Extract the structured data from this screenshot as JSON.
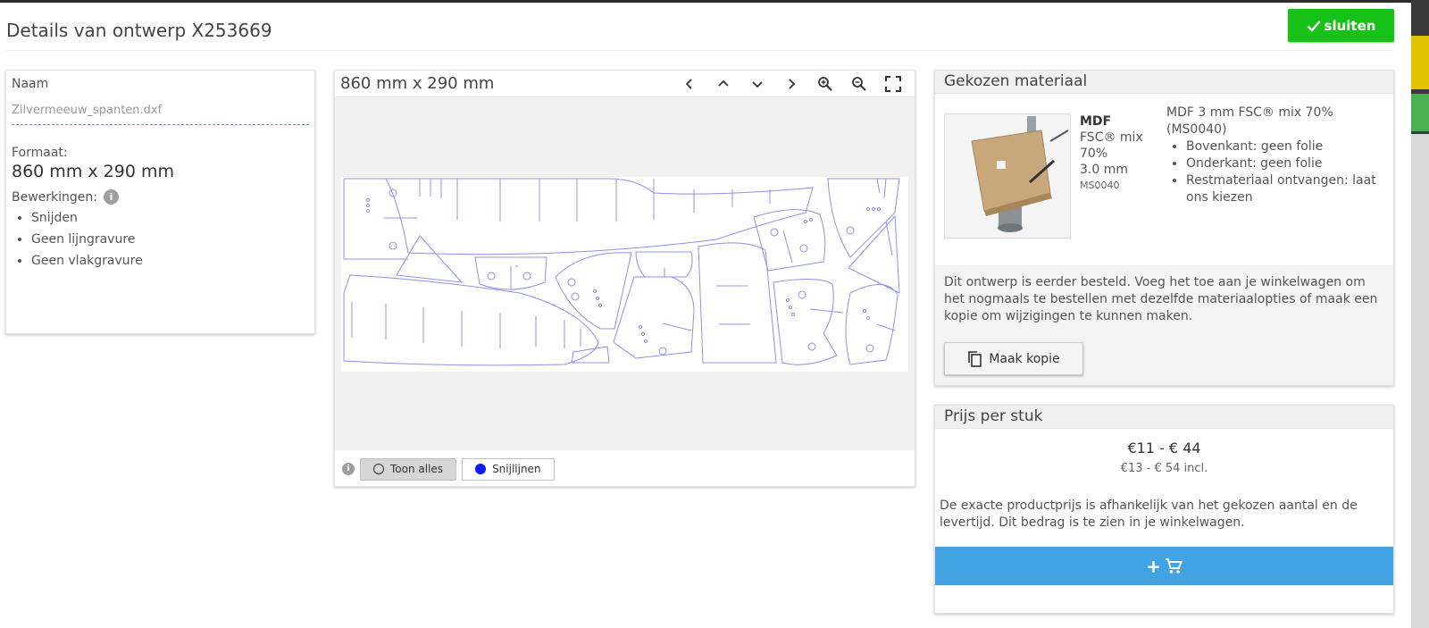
{
  "header": {
    "title": "Details van ontwerp X253669",
    "close_label": "sluiten"
  },
  "left": {
    "name_label": "Naam",
    "name_value": "Zilvermeeuw_spanten.dxf",
    "format_label": "Formaat:",
    "format_value": "860 mm x 290 mm",
    "processing_label": "Bewerkingen:",
    "processing_items": [
      "Snijden",
      "Geen lijngravure",
      "Geen vlakgravure"
    ]
  },
  "viewer": {
    "dimensions": "860 mm x 290 mm",
    "tools": [
      "chevron-left-icon",
      "chevron-up-icon",
      "chevron-down-icon",
      "chevron-right-icon",
      "zoom-in-icon",
      "zoom-out-icon",
      "fullscreen-icon"
    ],
    "show_all_label": "Toon alles",
    "cut_lines_label": "Snijlijnen",
    "cut_line_color": "#0b1cf5",
    "drawing_stroke_color": "#8f8ff0"
  },
  "material": {
    "heading": "Gekozen materiaal",
    "short_name": "MDF",
    "short_desc": "FSC® mix 70%",
    "thickness": "3.0 mm",
    "code": "MS0040",
    "full_name": "MDF 3 mm FSC® mix 70% (MS0040)",
    "features": [
      "Bovenkant: geen folie",
      "Onderkant: geen folie",
      "Restmateriaal ontvangen: laat ons kiezen"
    ],
    "reorder_note": "Dit ontwerp is eerder besteld. Voeg het toe aan je winkelwagen om het nogmaals te bestellen met dezelfde materiaalopties of maak een kopie om wijzigingen te kunnen maken.",
    "copy_label": "Maak kopie"
  },
  "price": {
    "heading": "Prijs per stuk",
    "range": "€11 - € 44",
    "range_incl": "€13 - € 54 incl.",
    "note": "De exacte productprijs is afhankelijk van het gekozen aantal en de levertijd. Dit bedrag is te zien in je winkelwagen.",
    "cart_label": "+"
  },
  "colors": {
    "close_button": "#18c118",
    "cart_button": "#43a3e2"
  }
}
